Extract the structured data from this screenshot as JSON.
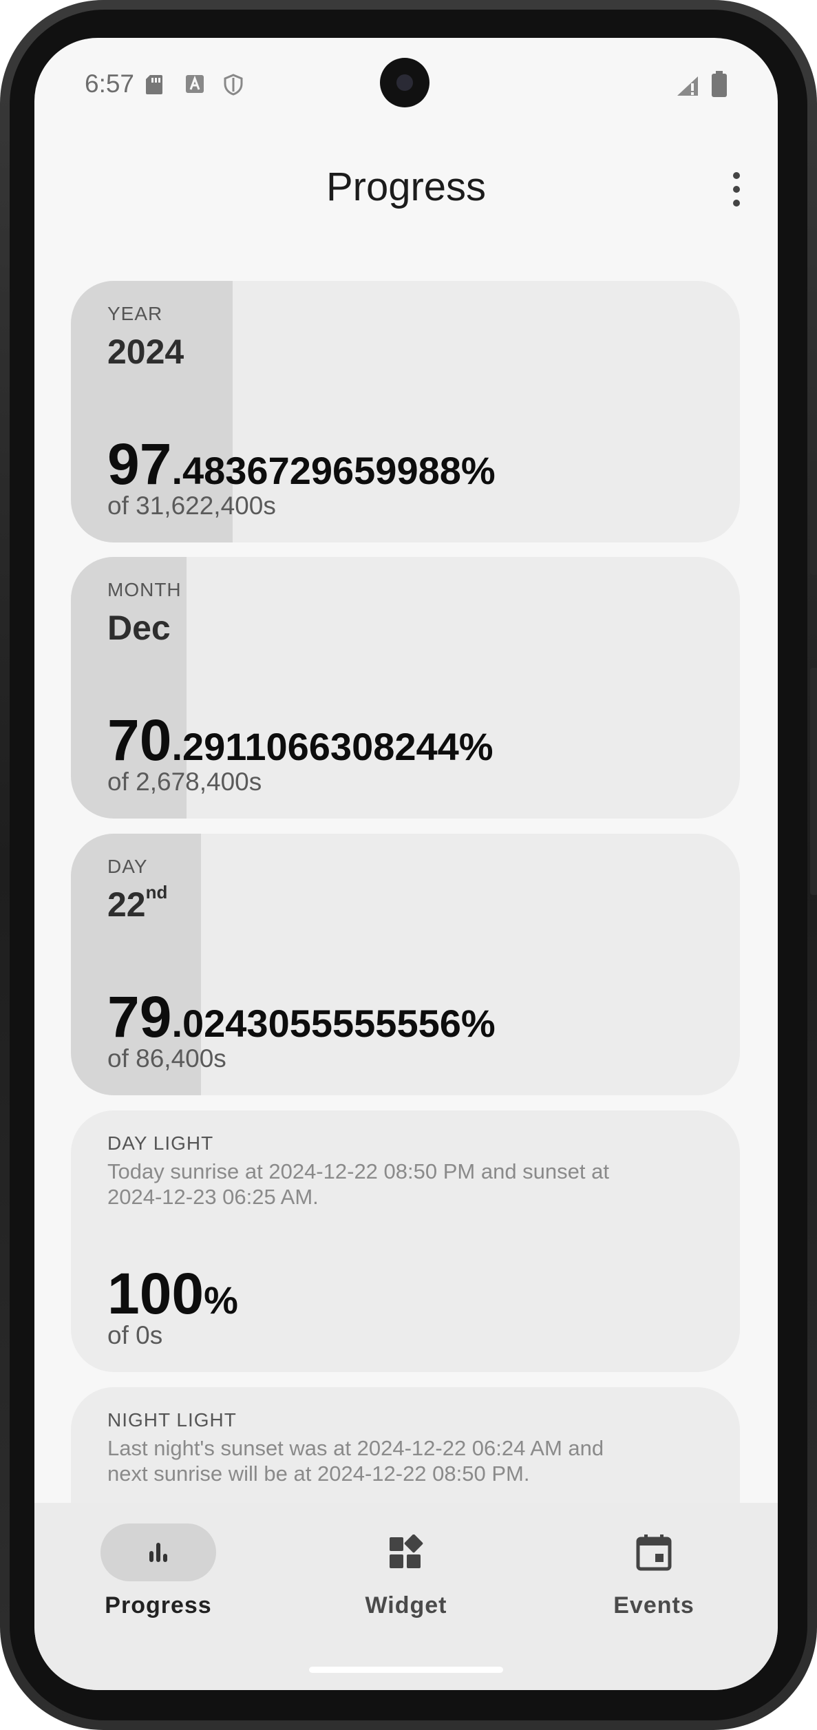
{
  "status_bar": {
    "time": "6:57"
  },
  "app_bar": {
    "title": "Progress"
  },
  "cards": [
    {
      "label": "YEAR",
      "period": "2024",
      "percent_int": "97",
      "percent_dec": ".4836729659988%",
      "total": "of 31,622,400s",
      "progress_fraction": 0.24
    },
    {
      "label": "MONTH",
      "period": "Dec",
      "percent_int": "70",
      "percent_dec": ".2911066308244%",
      "total": "of 2,678,400s",
      "progress_fraction": 0.17
    },
    {
      "label": "DAY",
      "period": "22",
      "period_suffix": "nd",
      "percent_int": "79",
      "percent_dec": ".0243055555556%",
      "total": "of 86,400s",
      "progress_fraction": 0.195
    },
    {
      "label": "DAY LIGHT",
      "description": "Today sunrise at 2024-12-22 08:50 PM and sunset at 2024-12-23 06:25 AM.",
      "percent_int": "100",
      "percent_dec": "%",
      "total": "of 0s"
    },
    {
      "label": "NIGHT LIGHT",
      "description": "Last night's sunset was at 2024-12-22 06:24 AM and next sunrise will be at 2024-12-22 08:50 PM."
    }
  ],
  "nav": [
    {
      "label": "Progress",
      "icon": "bar-chart-icon",
      "active": true
    },
    {
      "label": "Widget",
      "icon": "widgets-icon",
      "active": false
    },
    {
      "label": "Events",
      "icon": "calendar-icon",
      "active": false
    }
  ],
  "colors": {
    "screen_bg": "#f7f7f7",
    "card_bg": "#ececec",
    "card_fill": "#d6d6d6",
    "nav_bg": "#ebebeb",
    "active_pill": "#d4d4d4"
  }
}
